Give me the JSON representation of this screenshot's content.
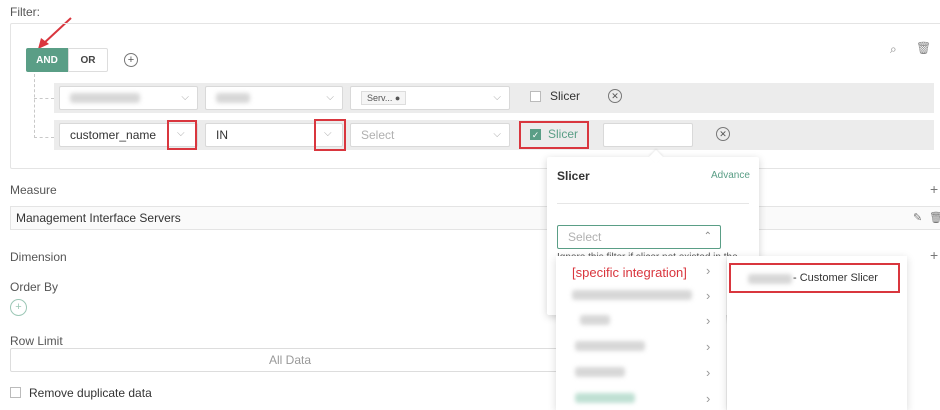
{
  "filter": {
    "label": "Filter:",
    "and_label": "AND",
    "or_label": "OR",
    "row1": {
      "operator_value": "Serv... ●",
      "slicer_label": "Slicer"
    },
    "row2": {
      "field_value": "customer_name",
      "operator_value": "IN",
      "value_placeholder": "Select",
      "slicer_label": "Slicer",
      "slicer_checked": true
    }
  },
  "slicer_panel": {
    "title": "Slicer",
    "advance_label": "Advance",
    "select_placeholder": "Select",
    "hint_text": "Ignore this filter if slicer not existed in the"
  },
  "dropdown": {
    "first_item": "[specific integration]",
    "sub_item_suffix": "- Customer Slicer"
  },
  "measure": {
    "label": "Measure",
    "value": "Management Interface Servers"
  },
  "dimension": {
    "label": "Dimension"
  },
  "order_by": {
    "label": "Order By"
  },
  "row_limit": {
    "label": "Row Limit",
    "value": "All Data"
  },
  "remove_duplicate": {
    "label": "Remove duplicate data"
  },
  "colors": {
    "accent": "#5a9e86",
    "highlight": "#d9363e"
  }
}
